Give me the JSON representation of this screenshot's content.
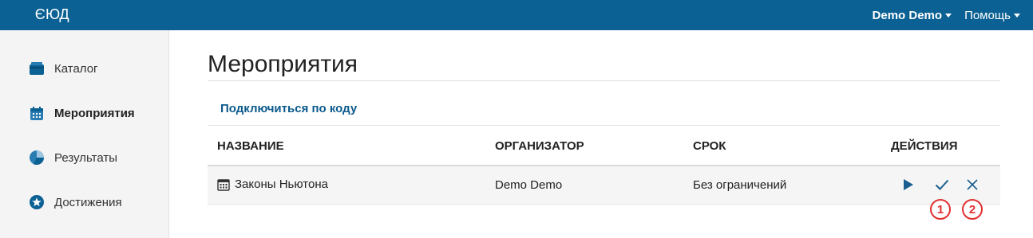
{
  "app": {
    "logo_mirrored": "Э",
    "logo_rest": "ЮД"
  },
  "topbar": {
    "user_menu": "Demo Demo",
    "help_menu": "Помощь"
  },
  "sidebar": {
    "items": [
      {
        "label": "Каталог",
        "icon": "catalog-icon"
      },
      {
        "label": "Мероприятия",
        "icon": "calendar-icon",
        "active": true
      },
      {
        "label": "Результаты",
        "icon": "pie-chart-icon"
      },
      {
        "label": "Достижения",
        "icon": "star-badge-icon"
      }
    ]
  },
  "main": {
    "title": "Мероприятия",
    "connect_link": "Подключиться по коду",
    "table": {
      "headers": [
        "НАЗВАНИЕ",
        "ОРГАНИЗАТОР",
        "СРОК",
        "ДЕЙСТВИЯ"
      ],
      "rows": [
        {
          "name": "Законы Ньютона",
          "organizer": "Demo Demo",
          "term": "Без ограничений"
        }
      ]
    },
    "annotations": [
      "1",
      "2"
    ]
  },
  "colors": {
    "topbar": "#0b6194",
    "link": "#0b5a8c",
    "action": "#1a5f8f",
    "annotation": "#e03030"
  }
}
